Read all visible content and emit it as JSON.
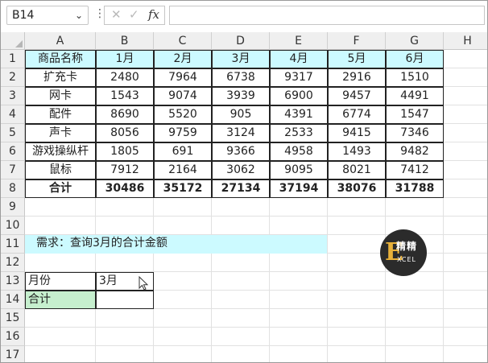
{
  "formula_bar": {
    "name_box": "B14",
    "chevron": "⌄",
    "more": "⋮",
    "cancel_icon": "✕",
    "enter_icon": "✓",
    "fx": "fx",
    "formula": ""
  },
  "columns": [
    "A",
    "B",
    "C",
    "D",
    "E",
    "F",
    "G",
    "H"
  ],
  "rows": [
    "1",
    "2",
    "3",
    "4",
    "5",
    "6",
    "7",
    "8",
    "9",
    "10",
    "11",
    "12",
    "13",
    "14",
    "15",
    "16",
    "17"
  ],
  "table": {
    "header": [
      "商品名称",
      "1月",
      "2月",
      "3月",
      "4月",
      "5月",
      "6月"
    ],
    "body": [
      [
        "扩充卡",
        "2480",
        "7964",
        "6738",
        "9317",
        "2916",
        "1510"
      ],
      [
        "网卡",
        "1543",
        "9074",
        "3939",
        "6900",
        "9457",
        "4491"
      ],
      [
        "配件",
        "8690",
        "5520",
        "905",
        "4391",
        "6774",
        "1547"
      ],
      [
        "声卡",
        "8056",
        "9759",
        "3124",
        "2533",
        "9415",
        "7346"
      ],
      [
        "游戏操纵杆",
        "1805",
        "691",
        "9366",
        "4958",
        "1493",
        "9482"
      ],
      [
        "鼠标",
        "7912",
        "2164",
        "3062",
        "9095",
        "8021",
        "7412"
      ]
    ],
    "total": [
      "合计",
      "30486",
      "35172",
      "27134",
      "37194",
      "38076",
      "31788"
    ]
  },
  "note": "需求：查询3月的合计金额",
  "lookup": {
    "month_label": "月份",
    "month_value": "3月",
    "total_label": "合计",
    "total_value": ""
  },
  "logo": {
    "letter": "E",
    "text1": "精精",
    "text2": "XCEL"
  },
  "colors": {
    "header_fill": "#ccfaff",
    "total_label_fill": "#c6efce",
    "logo_bg": "#2b2b2b",
    "logo_accent": "#e8b13a"
  }
}
